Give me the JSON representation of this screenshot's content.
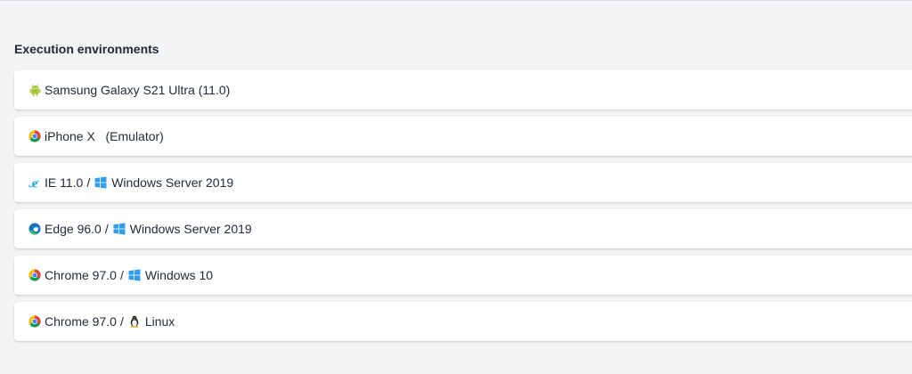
{
  "section": {
    "title": "Execution environments"
  },
  "environments": [
    {
      "browser_icon": "android-icon",
      "browser_label": "Samsung Galaxy S21 Ultra (11.0)"
    },
    {
      "browser_icon": "chrome-icon",
      "browser_label": "iPhone X   (Emulator)"
    },
    {
      "browser_icon": "internet-explorer-icon",
      "browser_label": "IE 11.0",
      "separator": "/",
      "os_icon": "windows-icon",
      "os_label": "Windows Server 2019"
    },
    {
      "browser_icon": "edge-icon",
      "browser_label": "Edge 96.0",
      "separator": "/",
      "os_icon": "windows-icon",
      "os_label": "Windows Server 2019"
    },
    {
      "browser_icon": "chrome-icon",
      "browser_label": "Chrome 97.0",
      "separator": "/",
      "os_icon": "windows-icon",
      "os_label": "Windows 10"
    },
    {
      "browser_icon": "chrome-icon",
      "browser_label": "Chrome 97.0",
      "separator": "/",
      "os_icon": "linux-icon",
      "os_label": "Linux"
    }
  ],
  "colors": {
    "page_background": "#f3f4f6",
    "card_background": "#ffffff",
    "text": "#1f2937",
    "android_green": "#a4c639",
    "windows_blue": "#2f9ef0",
    "ie_blue": "#2fa9e6",
    "edge_blue": "#1b6fb7",
    "edge_green": "#2fbf71"
  }
}
